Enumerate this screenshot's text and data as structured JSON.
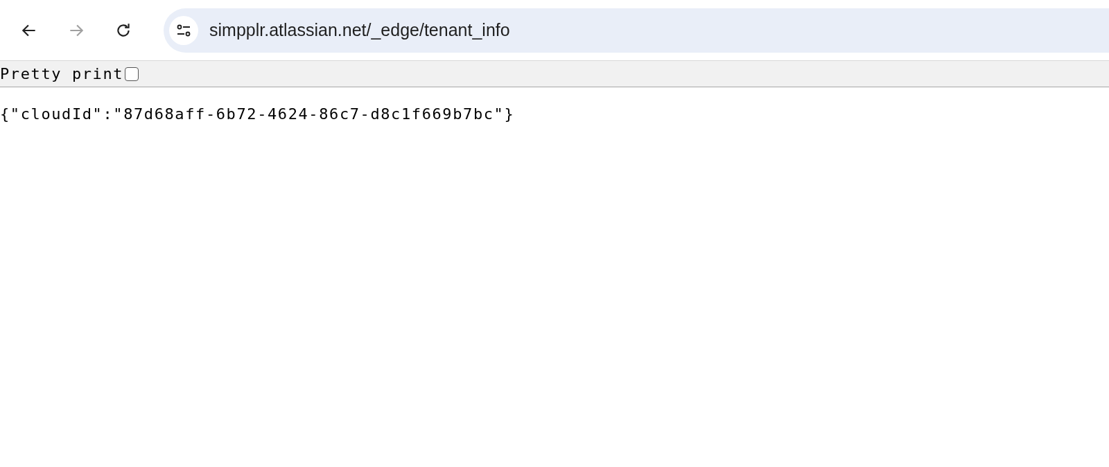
{
  "toolbar": {
    "nav_buttons": [
      {
        "kind": "back",
        "disabled": false
      },
      {
        "kind": "forward",
        "disabled": true
      },
      {
        "kind": "reload",
        "disabled": false
      }
    ],
    "address_bar": {
      "url": "simpplr.atlassian.net/_edge/tenant_info"
    }
  },
  "viewer_bar": {
    "label": "Pretty print",
    "checked": false
  },
  "content": {
    "text": "{\"cloudId\":\"87d68aff-6b72-4624-86c7-d8c1f669b7bc\"}"
  }
}
